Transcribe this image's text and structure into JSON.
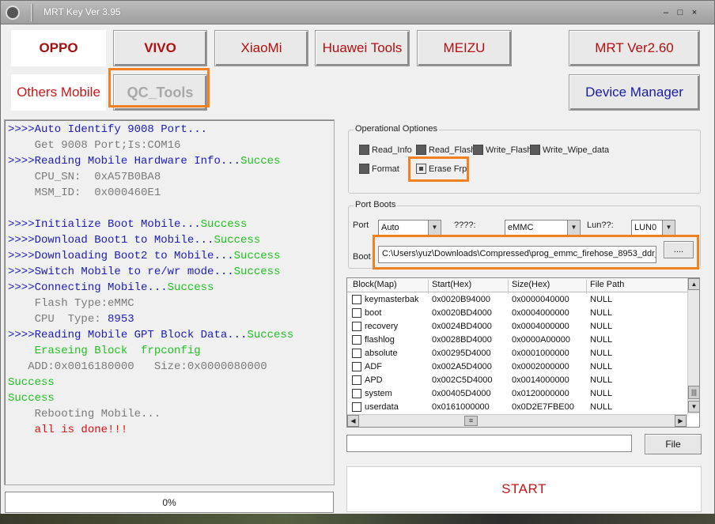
{
  "window": {
    "title": "MRT Key Ver 3.95",
    "minimize": "–",
    "maximize": "□",
    "close": "×"
  },
  "tabs": {
    "oppo": "OPPO",
    "vivo": "VIVO",
    "xiaomi": "XiaoMi",
    "huawei": "Huawei Tools",
    "meizu": "MEIZU",
    "mrt_ver": "MRT Ver2.60",
    "others": "Others Mobile",
    "qc_tools": "QC_Tools",
    "device_manager": "Device Manager"
  },
  "log": [
    {
      "text": ">>>>Auto Identify 9008 Port...",
      "color": "blue"
    },
    {
      "text": "    Get 9008 Port;Is:COM16",
      "color": "gray"
    },
    {
      "text": ">>>>Reading Mobile Hardware Info...",
      "color": "blue",
      "suffix": "Succes"
    },
    {
      "text": "    CPU_SN:  0xA57B0BA8",
      "color": "gray"
    },
    {
      "text": "    MSM_ID:  0x000460E1",
      "color": "gray"
    },
    {
      "text": "",
      "color": "gray"
    },
    {
      "text": ">>>>Initialize Boot Mobile...",
      "color": "blue",
      "suffix": "Success"
    },
    {
      "text": ">>>>Download Boot1 to Mobile...",
      "color": "blue",
      "suffix": "Success"
    },
    {
      "text": ">>>>Downloading Boot2 to Mobile...",
      "color": "blue",
      "suffix": "Success"
    },
    {
      "text": ">>>>Switch Mobile to re/wr mode...",
      "color": "blue",
      "suffix": "Success"
    },
    {
      "text": ">>>>Connecting Mobile...",
      "color": "blue",
      "suffix": "Success"
    },
    {
      "text": "    Flash Type:eMMC",
      "color": "gray"
    },
    {
      "text": "    CPU  Type: ",
      "color": "gray",
      "suffix_blue": "8953"
    },
    {
      "text": ">>>>Reading Mobile GPT Block Data...",
      "color": "blue",
      "suffix": "Success"
    },
    {
      "text": "    Eraseing Block  frpconfig",
      "color": "green"
    },
    {
      "text": "   ADD:0x0016180000   Size:0x0000080000",
      "color": "gray"
    },
    {
      "text": "Success",
      "color": "green"
    },
    {
      "text": "Success",
      "color": "green"
    },
    {
      "text": "    Rebooting Mobile...",
      "color": "gray"
    },
    {
      "text": "    all is done!!!",
      "color": "red"
    }
  ],
  "progress": {
    "value_text": "0%",
    "fraction": 0
  },
  "operational": {
    "title": "Operational Optiones",
    "read_info": "Read_Info",
    "read_flash": "Read_Flash",
    "write_flash": "Write_Flash",
    "write_wipe_data": "Write_Wipe_data",
    "format": "Format",
    "erase_frp": "Erase Frp"
  },
  "port_boots": {
    "title": "Port Boots",
    "port_label": "Port",
    "port_value": "Auto",
    "storage_label": "????:",
    "storage_value": "eMMC",
    "lun_label": "Lun??:",
    "lun_value": "LUN0",
    "boot_label": "Boot",
    "boot_path": "C:\\Users\\yuz\\Downloads\\Compressed\\prog_emmc_firehose_8953_ddr_...",
    "browse_label": "...."
  },
  "block_table": {
    "headers": [
      "Block(Map)",
      "Start(Hex)",
      "Size(Hex)",
      "File Path"
    ],
    "rows": [
      [
        "keymasterbak",
        "0x0020B94000",
        "0x0000040000",
        "NULL"
      ],
      [
        "boot",
        "0x0020BD4000",
        "0x0004000000",
        "NULL"
      ],
      [
        "recovery",
        "0x0024BD4000",
        "0x0004000000",
        "NULL"
      ],
      [
        "flashlog",
        "0x0028BD4000",
        "0x0000A00000",
        "NULL"
      ],
      [
        "absolute",
        "0x00295D4000",
        "0x0001000000",
        "NULL"
      ],
      [
        "ADF",
        "0x002A5D4000",
        "0x0002000000",
        "NULL"
      ],
      [
        "APD",
        "0x002C5D4000",
        "0x0014000000",
        "NULL"
      ],
      [
        "system",
        "0x00405D4000",
        "0x0120000000",
        "NULL"
      ],
      [
        "userdata",
        "0x0161000000",
        "0x0D2E7FBE00",
        "NULL"
      ]
    ]
  },
  "file_path_input": "",
  "file_button": "File",
  "start_button": "START",
  "colors": {
    "accent_highlight": "#f08020",
    "log_blue": "#1c1cb8",
    "log_green": "#1fc21f",
    "log_red": "#dd1010"
  }
}
